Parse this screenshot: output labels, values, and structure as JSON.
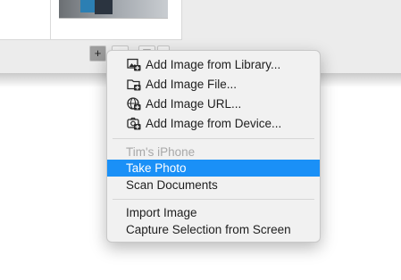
{
  "background": {
    "toolbar_buttons": [
      "+",
      "−",
      "⊟",
      "▾"
    ]
  },
  "menu": {
    "accent_color": "#1a90f7",
    "image_items": [
      {
        "label": "Add Image from Library...",
        "icon": "photo-library-icon"
      },
      {
        "label": "Add Image File...",
        "icon": "folder-icon"
      },
      {
        "label": "Add Image URL...",
        "icon": "globe-icon"
      },
      {
        "label": "Add Image from Device...",
        "icon": "camera-icon"
      }
    ],
    "device_header": "Tim's iPhone",
    "device_items": [
      "Take Photo",
      "Scan Documents"
    ],
    "capture_items": [
      "Import Image",
      "Capture Selection from Screen"
    ],
    "selected_item": "Take Photo"
  }
}
